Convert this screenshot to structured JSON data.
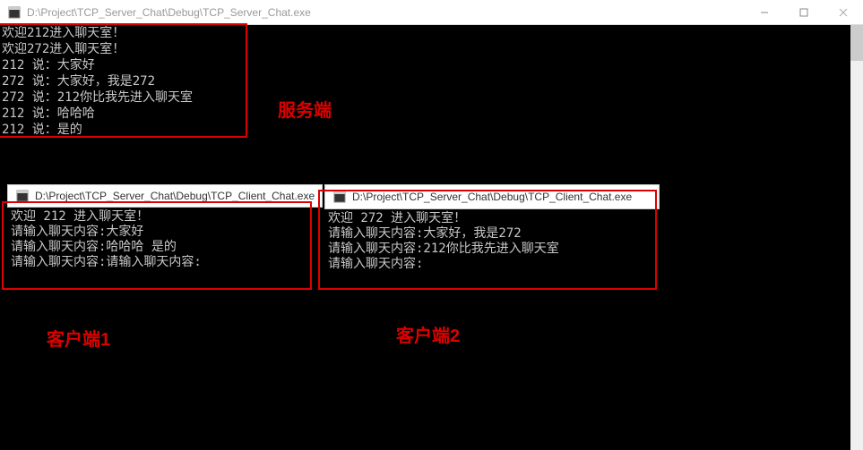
{
  "main": {
    "title": "D:\\Project\\TCP_Server_Chat\\Debug\\TCP_Server_Chat.exe",
    "server_lines": [
      "欢迎212进入聊天室！",
      "欢迎272进入聊天室！",
      "212 说：大家好",
      "272 说：大家好，我是272",
      "272 说：212你比我先进入聊天室",
      "212 说：哈哈哈",
      "212 说：是的"
    ]
  },
  "labels": {
    "server": "服务端",
    "client1": "客户端1",
    "client2": "客户端2"
  },
  "client1": {
    "title": "D:\\Project\\TCP_Server_Chat\\Debug\\TCP_Client_Chat.exe",
    "lines": [
      "欢迎 212 进入聊天室！",
      "请输入聊天内容:大家好",
      "请输入聊天内容:哈哈哈 是的",
      "请输入聊天内容:请输入聊天内容:"
    ]
  },
  "client2": {
    "title": "D:\\Project\\TCP_Server_Chat\\Debug\\TCP_Client_Chat.exe",
    "lines": [
      "欢迎 272 进入聊天室！",
      "请输入聊天内容:大家好，我是272",
      "请输入聊天内容:212你比我先进入聊天室",
      "请输入聊天内容:"
    ]
  }
}
